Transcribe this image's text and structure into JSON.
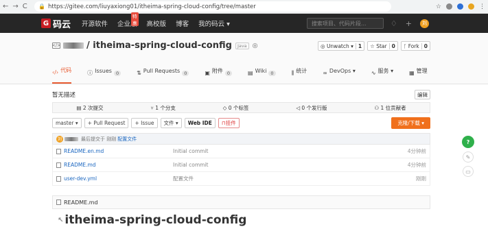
{
  "browser": {
    "back": "←",
    "forward": "→",
    "reload": "C",
    "url": "https://gitee.com/liuyaxiong01/itheima-spring-cloud-config/tree/master"
  },
  "topbar": {
    "logo_text": "码云",
    "nav": [
      "开源软件",
      "企业版",
      "高校版",
      "博客",
      "我的码云 ▾"
    ],
    "hot_badge": "特惠",
    "search_placeholder": "搜索项目、代码片段...",
    "avatar_text": "刘"
  },
  "repo": {
    "name": "/ itheima-spring-cloud-config",
    "lang_badge": "Java",
    "watch_label": "◎ Unwatch ▾",
    "watch_count": "1",
    "star_label": "☆ Star",
    "star_count": "0",
    "fork_label": "ᚴ Fork",
    "fork_count": "0",
    "tabs": [
      {
        "label": "代码",
        "count": ""
      },
      {
        "label": "Issues",
        "count": "0"
      },
      {
        "label": "Pull Requests",
        "count": "0"
      },
      {
        "label": "附件",
        "count": "0"
      },
      {
        "label": "Wiki",
        "count": "0"
      },
      {
        "label": "统计",
        "count": ""
      },
      {
        "label": "DevOps ▾",
        "count": ""
      },
      {
        "label": "服务 ▾",
        "count": ""
      },
      {
        "label": "管理",
        "count": ""
      }
    ]
  },
  "desc": {
    "text": "暂无描述",
    "edit": "编辑"
  },
  "stats": {
    "commits": "2 次提交",
    "branches": "1 个分支",
    "tags": "0 个标签",
    "releases": "0 个发行版",
    "contributors": "1 位贡献者"
  },
  "toolbar": {
    "branch": "master ▾",
    "pull_request": "+ Pull Request",
    "issue": "+ Issue",
    "file": "文件 ▾",
    "webide": "Web IDE",
    "mount": "挂件",
    "clone": "克隆/下载 ▾"
  },
  "commit": {
    "avatar": "刘",
    "text": "最后提交于 刚刚",
    "link": "配置文件"
  },
  "files": [
    {
      "name": "README.en.md",
      "msg": "Initial commit",
      "time": "4分钟前"
    },
    {
      "name": "README.md",
      "msg": "Initial commit",
      "time": "4分钟前"
    },
    {
      "name": "user-dev.yml",
      "msg": "配置文件",
      "time": "刚刚"
    }
  ],
  "readme": {
    "header": "README.md",
    "title": "itheima-spring-cloud-config"
  },
  "float": {
    "help": "?"
  }
}
